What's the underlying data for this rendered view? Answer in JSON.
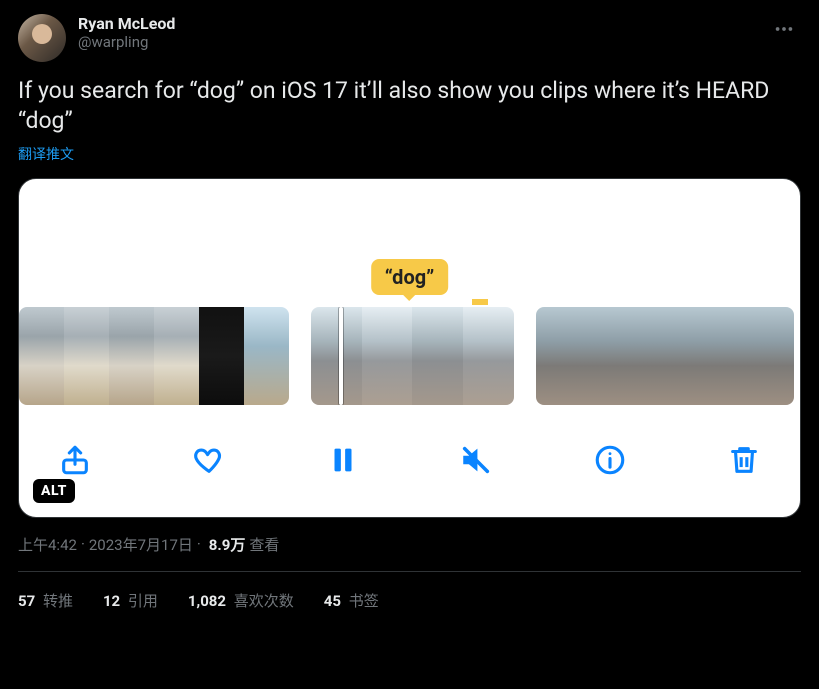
{
  "author": {
    "display_name": "Ryan McLeod",
    "handle": "@warpling"
  },
  "tweet": {
    "text": "If you search for “dog” on iOS 17 it’ll also show you clips where it’s HEARD “dog”",
    "translate_label": "翻译推文"
  },
  "media": {
    "caption_tag": "“dog”",
    "alt_badge": "ALT"
  },
  "meta": {
    "time": "上午4:42",
    "dot1": " · ",
    "date": "2023年7月17日",
    "dot2": " · ",
    "views_num": "8.9万",
    "views_label": " 查看"
  },
  "stats": {
    "retweets": {
      "num": "57",
      "label": " 转推"
    },
    "quotes": {
      "num": "12",
      "label": " 引用"
    },
    "likes": {
      "num": "1,082",
      "label": " 喜欢次数"
    },
    "bookmarks": {
      "num": "45",
      "label": " 书签"
    }
  }
}
